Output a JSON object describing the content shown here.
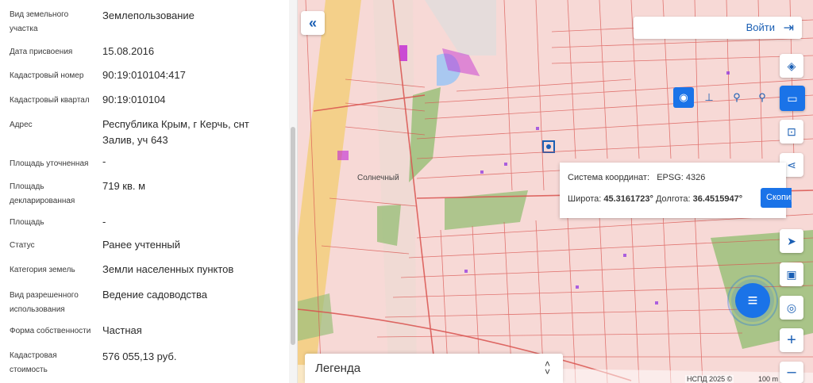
{
  "info": {
    "rows": [
      {
        "label": "Вид земельного участка",
        "value": "Землепользование"
      },
      {
        "label": "Дата присвоения",
        "value": "15.08.2016"
      },
      {
        "label": "Кадастровый номер",
        "value": "90:19:010104:417"
      },
      {
        "label": "Кадастровый квартал",
        "value": "90:19:010104"
      },
      {
        "label": "Адрес",
        "value": "Республика Крым, г Керчь, снт Залив, уч 643"
      },
      {
        "label": "Площадь уточненная",
        "value": "-"
      },
      {
        "label": "Площадь декларированная",
        "value": "719 кв. м"
      },
      {
        "label": "Площадь",
        "value": "-"
      },
      {
        "label": "Статус",
        "value": "Ранее учтенный"
      },
      {
        "label": "Категория земель",
        "value": "Земли населенных пунктов"
      },
      {
        "label": "Вид разрешенного использования",
        "value": "Ведение садоводства"
      },
      {
        "label": "Форма собственности",
        "value": "Частная"
      },
      {
        "label": "Кадастровая стоимость",
        "value": "576 055,13 руб."
      }
    ]
  },
  "header": {
    "login_label": "Войти"
  },
  "map": {
    "place_label": "Солнечный",
    "coordinates": {
      "system_label": "Система координат:",
      "system_value": "EPSG: 4326",
      "lat_label": "Широта:",
      "lat_value": "45.3161723°",
      "lon_label": "Долгота:",
      "lon_value": "36.4515947°",
      "copy_label": "Скопировать"
    },
    "copyright": "НСПД 2025 ©",
    "scale": "100 m"
  },
  "legend": {
    "label": "Легенда"
  },
  "icons": {
    "collapse": "double-chevron-left-icon",
    "login": "login-arrow-icon",
    "layers": "layers-icon",
    "ruler": "ruler-icon",
    "share": "share-icon",
    "locate": "locate-arrow-icon",
    "zoom_in": "plus-icon",
    "zoom_out": "minus-icon",
    "menu": "menu-lines-icon"
  },
  "colors": {
    "accent": "#1a73e8",
    "map_background": "#f7d9d6",
    "parcel_line": "#d9534f",
    "parcel_highlight": "#c026d3",
    "green_zone": "#9bbf7a",
    "water": "#a9c8f0",
    "road": "#f2c94c"
  }
}
